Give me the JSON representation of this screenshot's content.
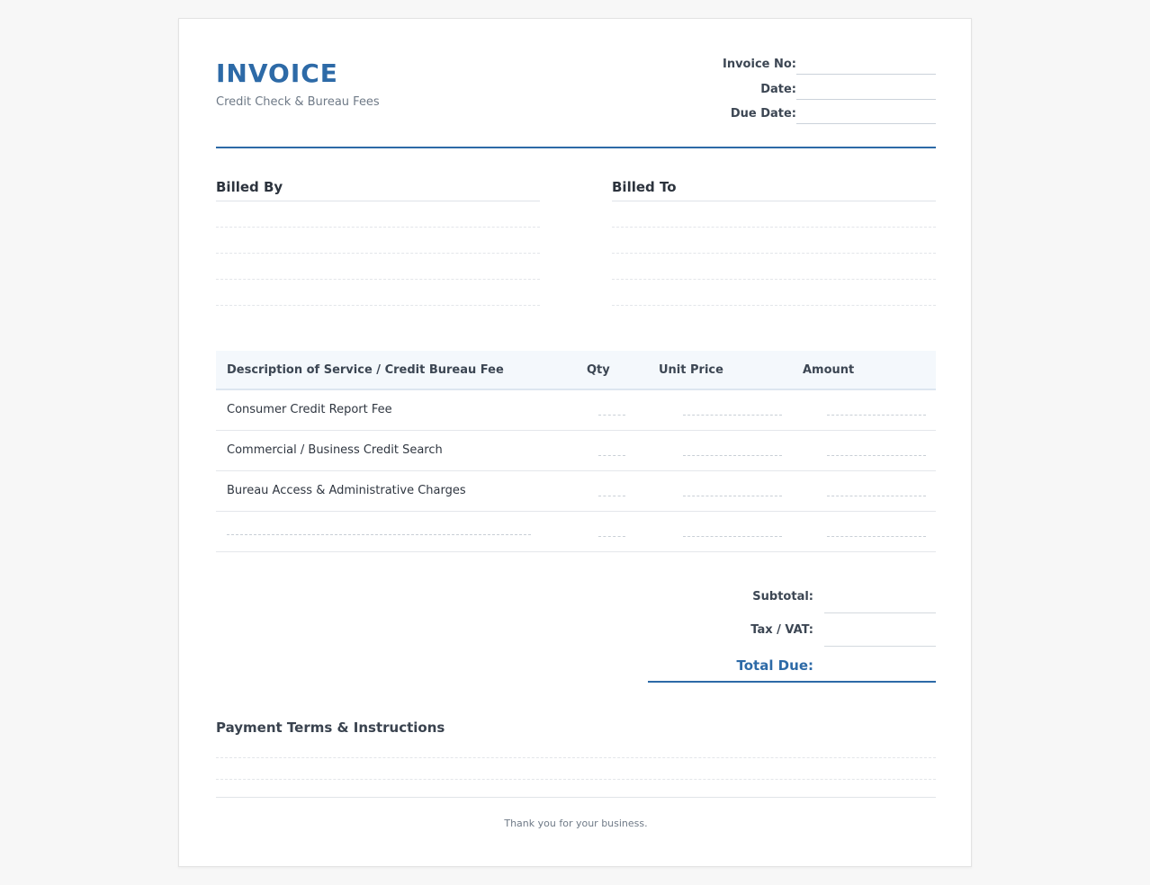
{
  "header": {
    "title": "INVOICE",
    "subtitle": "Credit Check & Bureau Fees",
    "meta": [
      {
        "label": "Invoice No:"
      },
      {
        "label": "Date:"
      },
      {
        "label": "Due Date:"
      }
    ]
  },
  "parties": {
    "billed_by": "Billed By",
    "billed_to": "Billed To"
  },
  "table": {
    "headers": {
      "description": "Description of Service / Credit Bureau Fee",
      "qty": "Qty",
      "unit_price": "Unit Price",
      "amount": "Amount"
    },
    "rows": [
      {
        "description": "Consumer Credit Report Fee"
      },
      {
        "description": "Commercial / Business Credit Search"
      },
      {
        "description": "Bureau Access & Administrative Charges"
      },
      {
        "description": ""
      }
    ]
  },
  "totals": {
    "subtotal_label": "Subtotal:",
    "tax_label": "Tax / VAT:",
    "total_label": "Total Due:"
  },
  "terms": {
    "title": "Payment Terms & Instructions"
  },
  "footer": {
    "thanks": "Thank you for your business."
  },
  "colors": {
    "accent": "#2d6aa7",
    "background": "#f7f7f7",
    "page": "#ffffff"
  }
}
